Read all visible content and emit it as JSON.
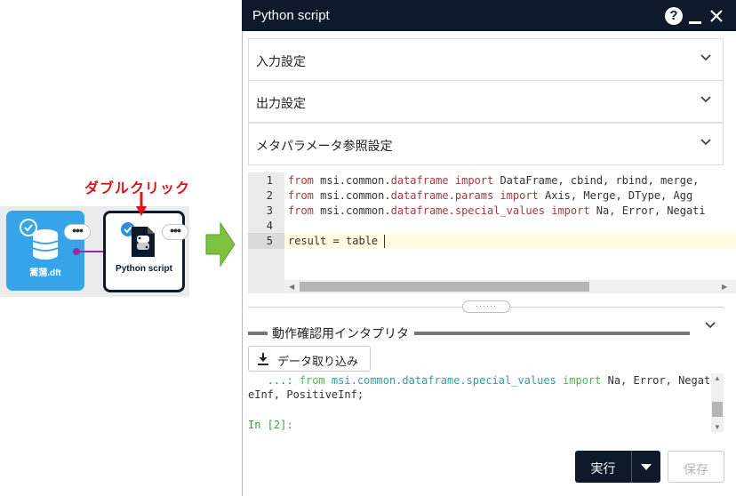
{
  "annotation": {
    "double_click_label": "ダブルクリック"
  },
  "workflow": {
    "node1": {
      "label": "蒿蒲.dft",
      "status": "checked",
      "menu": "•••"
    },
    "node2": {
      "label": "Python script",
      "status": "checked",
      "menu": "•••"
    }
  },
  "dialog": {
    "title": "Python script",
    "help_icon": "question-circle-icon",
    "accordion": [
      {
        "label": "入力設定"
      },
      {
        "label": "出力設定"
      },
      {
        "label": "メタパラメータ参照設定"
      }
    ],
    "editor": {
      "line_numbers": [
        "1",
        "2",
        "3",
        "4",
        "5"
      ],
      "lines": [
        {
          "kw1": "from",
          "mod": " msi.common.",
          "modname": "dataframe",
          "kw2": " import",
          "rest": " DataFrame, cbind, rbind, merge,"
        },
        {
          "kw1": "from",
          "mod": " msi.common.",
          "modname": "dataframe.params",
          "kw2": " import",
          "rest": " Axis, Merge, DType, Agg"
        },
        {
          "kw1": "from",
          "mod": " msi.common.",
          "modname": "dataframe.special_values",
          "kw2": " import",
          "rest": " Na, Error, Negati"
        },
        {
          "kw1": "",
          "mod": "",
          "modname": "",
          "kw2": "",
          "rest": ""
        },
        {
          "kw1": "",
          "mod": "",
          "modname": "",
          "kw2": "",
          "rest": "result = table"
        }
      ]
    },
    "interpreter": {
      "title": "動作確認用インタプリタ",
      "load_button": "データ取り込み",
      "console": {
        "line1_prefix": "   ...: ",
        "line1_from": "from",
        "line1_module": " msi.common.dataframe.special_values",
        "line1_import": " import",
        "line1_rest": " Na, Error, Negativ",
        "line2": "eInf, PositiveInf;",
        "prompt_in": "In [",
        "prompt_num": "2",
        "prompt_end": "]:"
      }
    },
    "footer": {
      "run_button": "実行",
      "save_button": "保存"
    }
  },
  "colors": {
    "titlebar": "#0e1a2b",
    "node_blue": "#35a4e8",
    "annotation_red": "#e01414",
    "arrow_green": "#7dc241",
    "link_purple": "#9b2aa8"
  }
}
